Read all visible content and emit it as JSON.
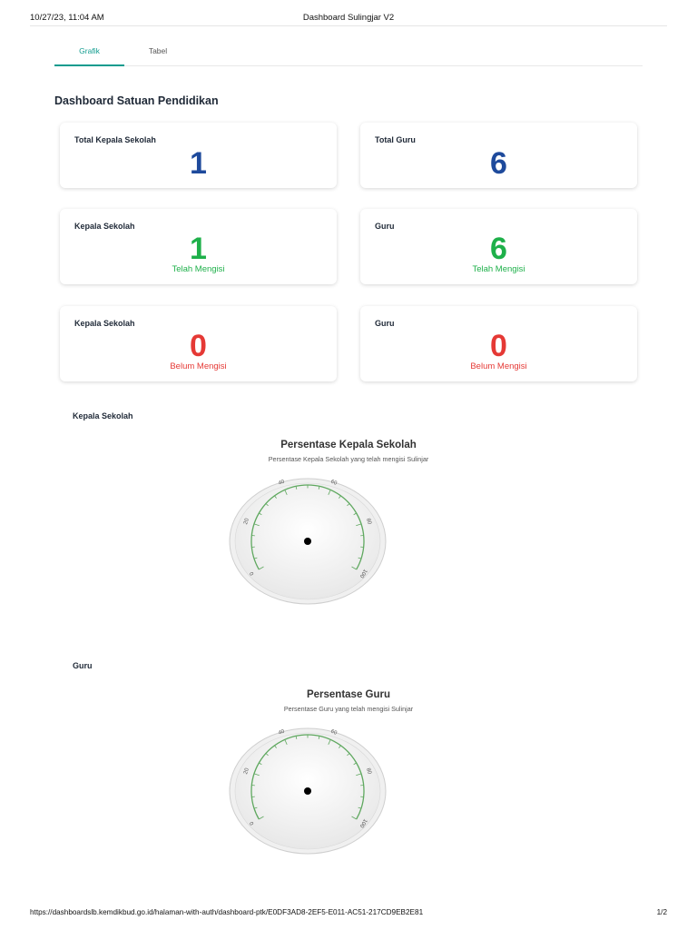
{
  "print_header": {
    "datetime": "10/27/23, 11:04 AM",
    "doc_title": "Dashboard Sulingjar V2"
  },
  "tabs": {
    "grafik": "Grafik",
    "tabel": "Tabel"
  },
  "section_title": "Dashboard Satuan Pendidikan",
  "cards": {
    "total_kepsek": {
      "label": "Total Kepala Sekolah",
      "value": "1"
    },
    "total_guru": {
      "label": "Total Guru",
      "value": "6"
    },
    "kepsek_mengisi": {
      "label": "Kepala Sekolah",
      "value": "1",
      "status": "Telah Mengisi"
    },
    "guru_mengisi": {
      "label": "Guru",
      "value": "6",
      "status": "Telah Mengisi"
    },
    "kepsek_belum": {
      "label": "Kepala Sekolah",
      "value": "0",
      "status": "Belum Mengisi"
    },
    "guru_belum": {
      "label": "Guru",
      "value": "0",
      "status": "Belum Mengisi"
    }
  },
  "colors": {
    "accent": "#0f9b8e",
    "blue": "#1e4a9c",
    "green": "#1eb04a",
    "red": "#e53935",
    "gauge_arc": "#5fa85f"
  },
  "chart_labels": {
    "kepsek": "Kepala Sekolah",
    "guru": "Guru"
  },
  "chart_data": [
    {
      "type": "gauge",
      "title": "Persentase Kepala Sekolah",
      "subtitle": "Persentase Kepala Sekolah yang telah mengisi Sulinjar",
      "min": 0,
      "max": 100,
      "ticks": [
        "0",
        "20",
        "40",
        "60",
        "80",
        "100"
      ]
    },
    {
      "type": "gauge",
      "title": "Persentase Guru",
      "subtitle": "Persentase Guru yang telah mengisi Sulinjar",
      "min": 0,
      "max": 100,
      "ticks": [
        "0",
        "20",
        "40",
        "60",
        "80",
        "100"
      ]
    }
  ],
  "print_footer": {
    "url": "https://dashboardslb.kemdikbud.go.id/halaman-with-auth/dashboard-ptk/E0DF3AD8-2EF5-E011-AC51-217CD9EB2E81",
    "page": "1/2"
  }
}
